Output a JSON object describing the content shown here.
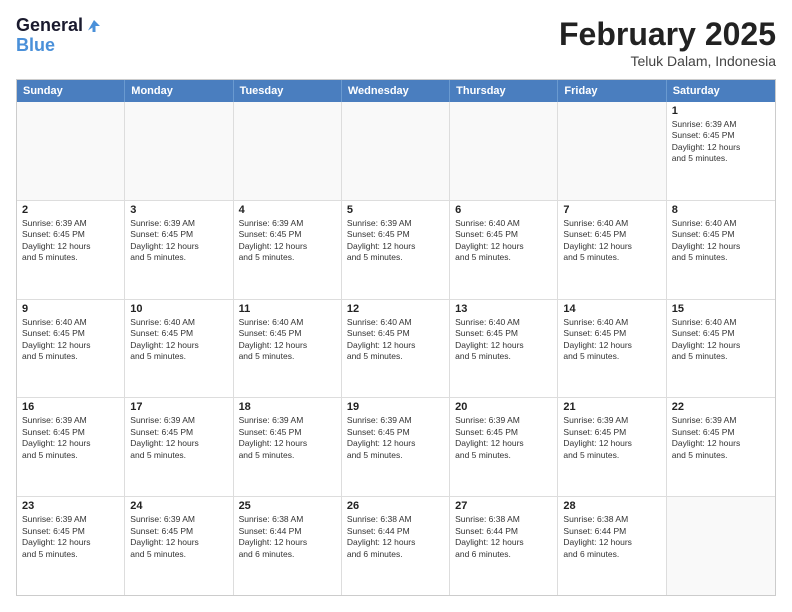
{
  "header": {
    "logo_line1": "General",
    "logo_line2": "Blue",
    "month": "February 2025",
    "location": "Teluk Dalam, Indonesia"
  },
  "weekdays": [
    "Sunday",
    "Monday",
    "Tuesday",
    "Wednesday",
    "Thursday",
    "Friday",
    "Saturday"
  ],
  "rows": [
    [
      {
        "day": "",
        "info": ""
      },
      {
        "day": "",
        "info": ""
      },
      {
        "day": "",
        "info": ""
      },
      {
        "day": "",
        "info": ""
      },
      {
        "day": "",
        "info": ""
      },
      {
        "day": "",
        "info": ""
      },
      {
        "day": "1",
        "info": "Sunrise: 6:39 AM\nSunset: 6:45 PM\nDaylight: 12 hours\nand 5 minutes."
      }
    ],
    [
      {
        "day": "2",
        "info": "Sunrise: 6:39 AM\nSunset: 6:45 PM\nDaylight: 12 hours\nand 5 minutes."
      },
      {
        "day": "3",
        "info": "Sunrise: 6:39 AM\nSunset: 6:45 PM\nDaylight: 12 hours\nand 5 minutes."
      },
      {
        "day": "4",
        "info": "Sunrise: 6:39 AM\nSunset: 6:45 PM\nDaylight: 12 hours\nand 5 minutes."
      },
      {
        "day": "5",
        "info": "Sunrise: 6:39 AM\nSunset: 6:45 PM\nDaylight: 12 hours\nand 5 minutes."
      },
      {
        "day": "6",
        "info": "Sunrise: 6:40 AM\nSunset: 6:45 PM\nDaylight: 12 hours\nand 5 minutes."
      },
      {
        "day": "7",
        "info": "Sunrise: 6:40 AM\nSunset: 6:45 PM\nDaylight: 12 hours\nand 5 minutes."
      },
      {
        "day": "8",
        "info": "Sunrise: 6:40 AM\nSunset: 6:45 PM\nDaylight: 12 hours\nand 5 minutes."
      }
    ],
    [
      {
        "day": "9",
        "info": "Sunrise: 6:40 AM\nSunset: 6:45 PM\nDaylight: 12 hours\nand 5 minutes."
      },
      {
        "day": "10",
        "info": "Sunrise: 6:40 AM\nSunset: 6:45 PM\nDaylight: 12 hours\nand 5 minutes."
      },
      {
        "day": "11",
        "info": "Sunrise: 6:40 AM\nSunset: 6:45 PM\nDaylight: 12 hours\nand 5 minutes."
      },
      {
        "day": "12",
        "info": "Sunrise: 6:40 AM\nSunset: 6:45 PM\nDaylight: 12 hours\nand 5 minutes."
      },
      {
        "day": "13",
        "info": "Sunrise: 6:40 AM\nSunset: 6:45 PM\nDaylight: 12 hours\nand 5 minutes."
      },
      {
        "day": "14",
        "info": "Sunrise: 6:40 AM\nSunset: 6:45 PM\nDaylight: 12 hours\nand 5 minutes."
      },
      {
        "day": "15",
        "info": "Sunrise: 6:40 AM\nSunset: 6:45 PM\nDaylight: 12 hours\nand 5 minutes."
      }
    ],
    [
      {
        "day": "16",
        "info": "Sunrise: 6:39 AM\nSunset: 6:45 PM\nDaylight: 12 hours\nand 5 minutes."
      },
      {
        "day": "17",
        "info": "Sunrise: 6:39 AM\nSunset: 6:45 PM\nDaylight: 12 hours\nand 5 minutes."
      },
      {
        "day": "18",
        "info": "Sunrise: 6:39 AM\nSunset: 6:45 PM\nDaylight: 12 hours\nand 5 minutes."
      },
      {
        "day": "19",
        "info": "Sunrise: 6:39 AM\nSunset: 6:45 PM\nDaylight: 12 hours\nand 5 minutes."
      },
      {
        "day": "20",
        "info": "Sunrise: 6:39 AM\nSunset: 6:45 PM\nDaylight: 12 hours\nand 5 minutes."
      },
      {
        "day": "21",
        "info": "Sunrise: 6:39 AM\nSunset: 6:45 PM\nDaylight: 12 hours\nand 5 minutes."
      },
      {
        "day": "22",
        "info": "Sunrise: 6:39 AM\nSunset: 6:45 PM\nDaylight: 12 hours\nand 5 minutes."
      }
    ],
    [
      {
        "day": "23",
        "info": "Sunrise: 6:39 AM\nSunset: 6:45 PM\nDaylight: 12 hours\nand 5 minutes."
      },
      {
        "day": "24",
        "info": "Sunrise: 6:39 AM\nSunset: 6:45 PM\nDaylight: 12 hours\nand 5 minutes."
      },
      {
        "day": "25",
        "info": "Sunrise: 6:38 AM\nSunset: 6:44 PM\nDaylight: 12 hours\nand 6 minutes."
      },
      {
        "day": "26",
        "info": "Sunrise: 6:38 AM\nSunset: 6:44 PM\nDaylight: 12 hours\nand 6 minutes."
      },
      {
        "day": "27",
        "info": "Sunrise: 6:38 AM\nSunset: 6:44 PM\nDaylight: 12 hours\nand 6 minutes."
      },
      {
        "day": "28",
        "info": "Sunrise: 6:38 AM\nSunset: 6:44 PM\nDaylight: 12 hours\nand 6 minutes."
      },
      {
        "day": "",
        "info": ""
      }
    ]
  ]
}
